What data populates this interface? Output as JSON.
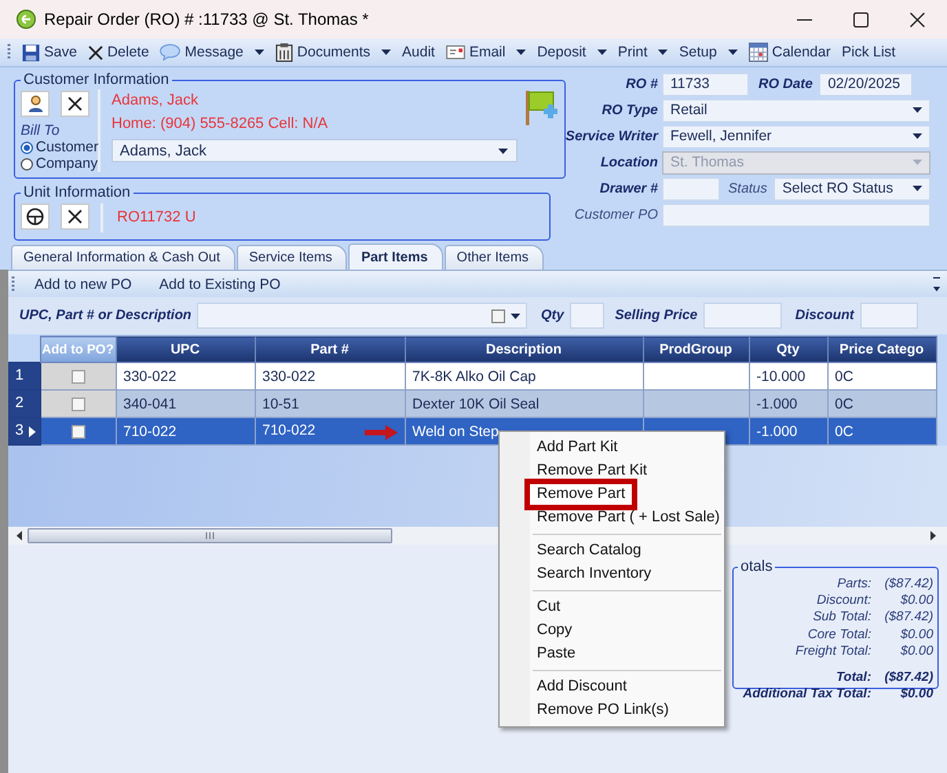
{
  "window": {
    "title": "Repair Order (RO) # :11733 @ St. Thomas *"
  },
  "toolbar": [
    {
      "label": "Save",
      "kind": "save",
      "dropdown": false
    },
    {
      "label": "Delete",
      "kind": "delete",
      "dropdown": false
    },
    {
      "label": "Message",
      "kind": "message",
      "dropdown": true
    },
    {
      "label": "Documents",
      "kind": "documents",
      "dropdown": true
    },
    {
      "label": "Audit",
      "kind": "plain",
      "dropdown": false
    },
    {
      "label": "Email",
      "kind": "email",
      "dropdown": true
    },
    {
      "label": "Deposit",
      "kind": "plain",
      "dropdown": true
    },
    {
      "label": "Print",
      "kind": "plain",
      "dropdown": true
    },
    {
      "label": "Setup",
      "kind": "plain",
      "dropdown": true
    },
    {
      "label": "Calendar",
      "kind": "calendar",
      "dropdown": false
    },
    {
      "label": "Pick List",
      "kind": "plain",
      "dropdown": false
    }
  ],
  "customer": {
    "legend": "Customer Information",
    "bill_to_label": "Bill To",
    "bill_to": [
      {
        "label": "Customer",
        "selected": true
      },
      {
        "label": "Company",
        "selected": false
      }
    ],
    "name": "Adams, Jack",
    "phone": "Home: (904) 555-8265 Cell: N/A",
    "contact": "Adams, Jack"
  },
  "unit": {
    "legend": "Unit Information",
    "unit": "RO11732 U"
  },
  "order_fields": [
    {
      "fields": [
        {
          "label": "RO #",
          "value": "11733",
          "kind": "text",
          "disabled": false,
          "label_bold": true
        },
        {
          "label": "RO Date",
          "value": "02/20/2025",
          "kind": "text",
          "disabled": false,
          "label_bold": true
        }
      ]
    },
    {
      "fields": [
        {
          "label": "RO Type",
          "value": "Retail",
          "kind": "dropdown",
          "disabled": false,
          "label_bold": true
        }
      ]
    },
    {
      "fields": [
        {
          "label": "Service Writer",
          "value": "Fewell, Jennifer",
          "kind": "dropdown",
          "disabled": false,
          "label_bold": true
        }
      ]
    },
    {
      "fields": [
        {
          "label": "Location",
          "value": "St. Thomas",
          "kind": "dropdown",
          "disabled": true,
          "label_bold": true
        }
      ]
    },
    {
      "fields": [
        {
          "label": "Drawer #",
          "kind": "text",
          "disabled": false,
          "label_bold": true
        },
        {
          "label": "Status",
          "value": "Select RO Status",
          "kind": "dropdown",
          "disabled": false,
          "label_bold": false
        }
      ]
    },
    {
      "fields": [
        {
          "label": "Customer PO",
          "kind": "text",
          "disabled": false,
          "label_bold": false
        }
      ]
    }
  ],
  "tabs": [
    {
      "label": "General Information & Cash Out",
      "selected": false
    },
    {
      "label": "Service Items",
      "selected": false
    },
    {
      "label": "Part Items",
      "selected": true
    },
    {
      "label": "Other Items",
      "selected": false
    }
  ],
  "po_actions": [
    "Add to new PO",
    "Add to Existing PO"
  ],
  "search": {
    "label": "UPC, Part # or Description",
    "filter_checked": false,
    "qty_label": "Qty",
    "price_label": "Selling Price",
    "discount_label": "Discount"
  },
  "grid": {
    "columns": [
      {
        "label": "Add to PO?",
        "kind": "check"
      },
      {
        "label": "UPC",
        "kind": "text"
      },
      {
        "label": "Part #",
        "kind": "text"
      },
      {
        "label": "Description",
        "kind": "text"
      },
      {
        "label": "ProdGroup",
        "kind": "text"
      },
      {
        "label": "Qty",
        "kind": "text"
      },
      {
        "label": "Price Catego",
        "kind": "text"
      }
    ],
    "rows": [
      {
        "number": "1",
        "selected": false,
        "add_to_po": false,
        "arrow": false,
        "cells": [
          "",
          "330-022",
          "330-022",
          "7K-8K Alko Oil Cap",
          "",
          "-10.000",
          "0C"
        ]
      },
      {
        "number": "2",
        "selected": false,
        "add_to_po": false,
        "arrow": false,
        "cells": [
          "",
          "340-041",
          "10-51",
          "Dexter 10K Oil Seal",
          "",
          "-1.000",
          "0C"
        ]
      },
      {
        "number": "3",
        "selected": true,
        "add_to_po": false,
        "arrow": true,
        "cells": [
          "",
          "710-022",
          "710-022",
          "Weld on Step",
          "",
          "-1.000",
          "0C"
        ]
      }
    ]
  },
  "totals": {
    "legend": "otals",
    "lines": [
      {
        "label": "Parts:",
        "value": "($87.42)",
        "kind": "normal"
      },
      {
        "label": "Discount:",
        "value": "$0.00",
        "kind": "normal"
      },
      {
        "label": "Sub Total:",
        "value": "($87.42)",
        "kind": "normal"
      },
      {
        "label": "Core Total:",
        "value": "$0.00",
        "kind": "normal"
      },
      {
        "label": "Freight Total:",
        "value": "$0.00",
        "kind": "normal"
      },
      {
        "label": "Total:",
        "value": "($87.42)",
        "kind": "grand"
      },
      {
        "label": "Additional Tax Total:",
        "value": "$0.00",
        "kind": "grand"
      }
    ]
  },
  "menu": {
    "groups": [
      {
        "items": [
          {
            "label": "Add Part Kit",
            "highlighted": false
          },
          {
            "label": "Remove Part Kit",
            "highlighted": false
          },
          {
            "label": "Remove Part",
            "highlighted": true
          },
          {
            "label": "Remove Part ( + Lost Sale)",
            "highlighted": false
          }
        ]
      },
      {
        "items": [
          {
            "label": "Search Catalog",
            "highlighted": false
          },
          {
            "label": "Search Inventory",
            "highlighted": false
          }
        ]
      },
      {
        "items": [
          {
            "label": "Cut",
            "highlighted": false
          },
          {
            "label": "Copy",
            "highlighted": false
          },
          {
            "label": "Paste",
            "highlighted": false
          }
        ]
      },
      {
        "items": [
          {
            "label": "Add Discount",
            "highlighted": false
          },
          {
            "label": "Remove PO Link(s)",
            "highlighted": false
          }
        ]
      }
    ]
  }
}
